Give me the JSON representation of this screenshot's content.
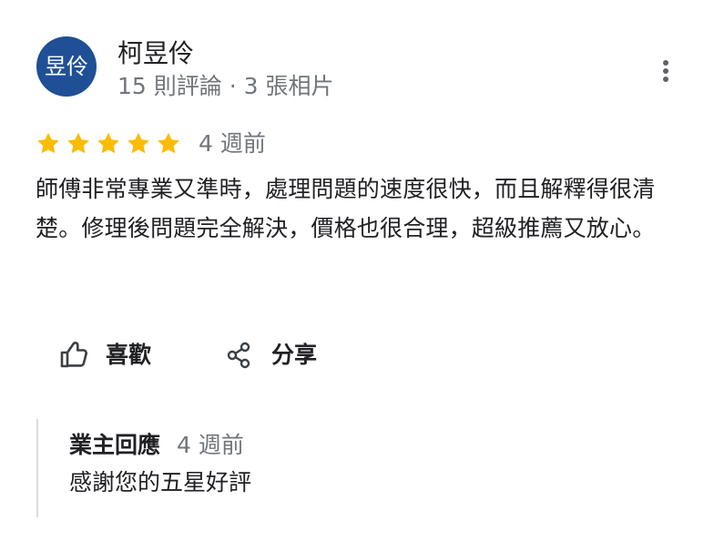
{
  "review": {
    "avatar_text": "昱伶",
    "reviewer_name": "柯昱伶",
    "reviewer_meta": "15 則評論 · 3 張相片",
    "rating_stars": 5,
    "time": "4 週前",
    "text": "師傅非常專業又準時，處理問題的速度很快，而且解釋得很清楚。修理後問題完全解決，價格也很合理，超級推薦又放心。"
  },
  "actions": {
    "like_label": "喜歡",
    "share_label": "分享"
  },
  "owner_reply": {
    "label": "業主回應",
    "time": "4 週前",
    "text": "感謝您的五星好評"
  },
  "colors": {
    "avatar_background": "#1f4f95",
    "star": "#fbbc04",
    "meta_text": "#70757a",
    "reply_border": "#dadce0"
  },
  "icons": {
    "more": "more-vert-icon",
    "star": "star-icon",
    "like": "thumb-up-icon",
    "share": "share-icon"
  }
}
